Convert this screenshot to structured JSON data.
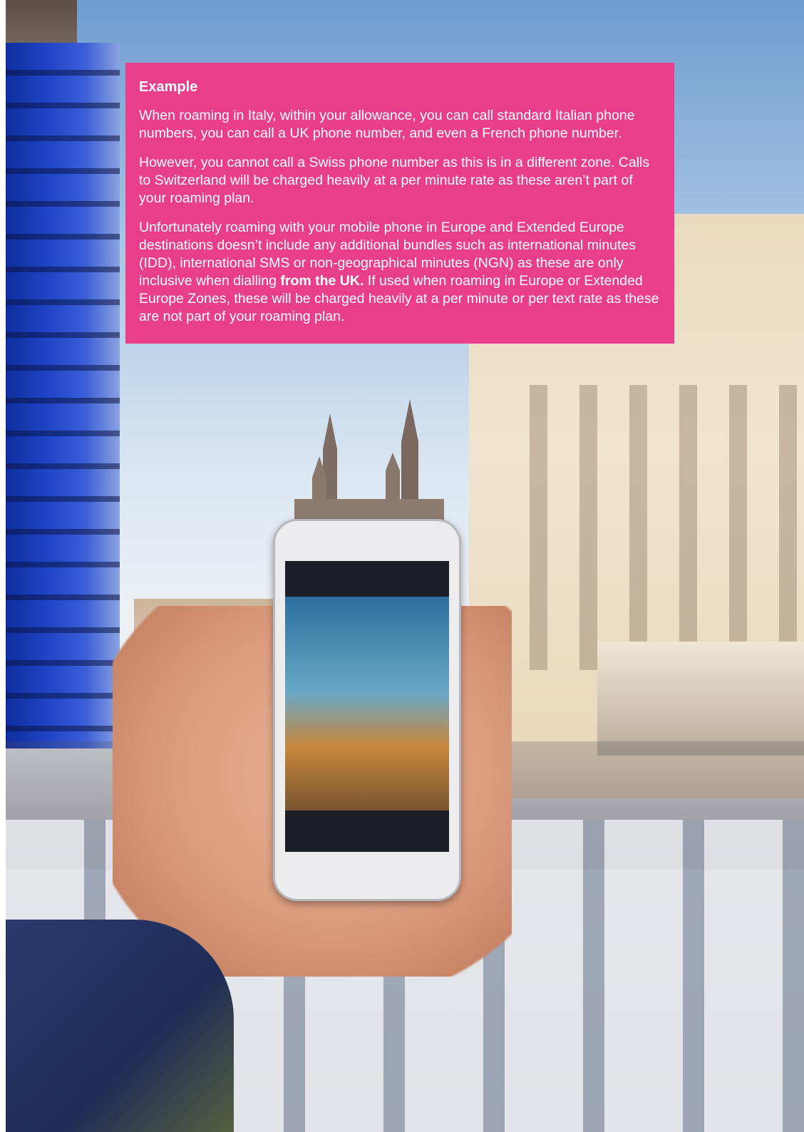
{
  "example_box": {
    "heading": "Example",
    "paragraph_1": "When roaming in Italy, within your allowance, you can call standard Italian phone numbers, you can call a UK phone number, and even a French phone number.",
    "paragraph_2": "However, you cannot call a Swiss phone number as this is in a different zone. Calls to Switzerland will be charged heavily at a per minute rate as these aren’t part of your roaming plan.",
    "paragraph_3_before": "Unfortunately roaming with your mobile phone in Europe and Extended Europe destinations doesn’t include any additional bundles such as international minutes (IDD), international SMS or non-geographical minutes (NGN) as these are only inclusive when dialling ",
    "paragraph_3_bold": "from the UK.",
    "paragraph_3_after": " If used when roaming in Europe or Extended Europe Zones, these will be charged heavily at a per minute or per text rate as these are not part of your roaming plan.",
    "background_color": "#e83e8c"
  }
}
